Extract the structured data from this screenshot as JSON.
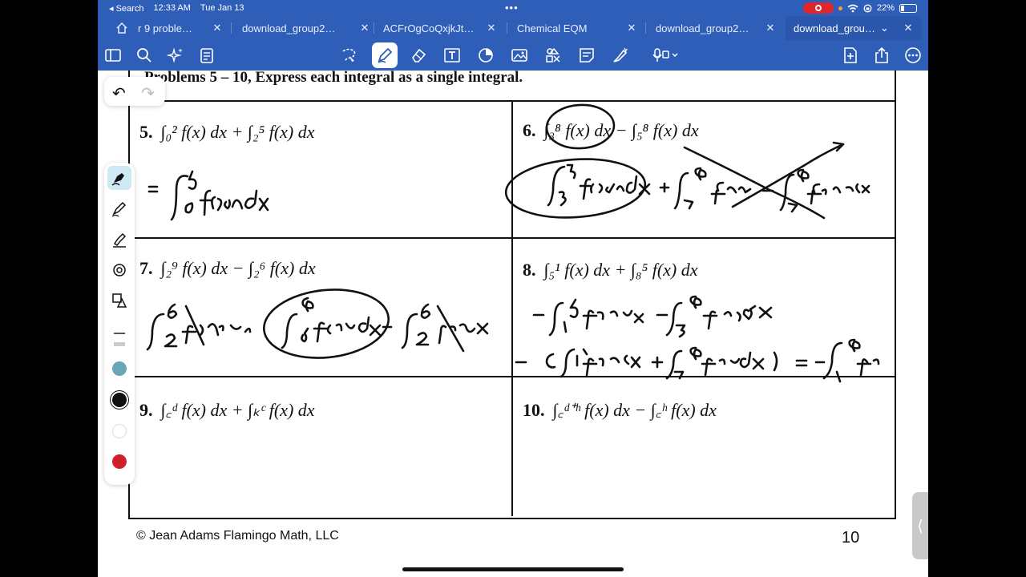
{
  "status_bar": {
    "back_label": "◂ Search",
    "time": "12:33 AM",
    "date": "Tue Jan 13",
    "more_dots": "•••",
    "battery": "22%"
  },
  "tabs": [
    {
      "label": "r 9 proble…",
      "close": "✕"
    },
    {
      "label": "download_group2…",
      "close": "✕"
    },
    {
      "label": "ACFrOgCoQxjkJt…",
      "close": "✕"
    },
    {
      "label": "Chemical EQM",
      "close": "✕"
    },
    {
      "label": "download_group2…",
      "close": "✕"
    },
    {
      "label": "download_grou…",
      "close": "✕",
      "chevron": "⌄"
    }
  ],
  "toolbar": {
    "icons": [
      "sidebar-icon",
      "search-icon",
      "sparkle-icon",
      "clipboard-icon",
      "lasso-icon",
      "pen-icon",
      "eraser-icon",
      "text-box-icon",
      "shape-icon",
      "image-icon",
      "stamp-icon",
      "note-icon",
      "highlighter-icon",
      "voice-icon",
      "add-page-icon",
      "share-icon",
      "more-icon"
    ]
  },
  "document": {
    "heading": "Problems 5 – 10, Express each integral as a single integral.",
    "problems": [
      {
        "number": "5.",
        "expr": "∫₀² f(x) dx + ∫₂⁵ f(x) dx"
      },
      {
        "number": "6.",
        "expr": "∫₃⁸ f(x) dx − ∫₅⁸ f(x) dx"
      },
      {
        "number": "7.",
        "expr": "∫₂⁹ f(x) dx − ∫₂⁶ f(x) dx"
      },
      {
        "number": "8.",
        "expr": "∫₅¹ f(x) dx + ∫₈⁵ f(x) dx"
      },
      {
        "number": "9.",
        "expr": "∫꜀ᵈ f(x) dx + ∫ₖᶜ f(x) dx"
      },
      {
        "number": "10.",
        "expr": "∫꜀ᵈ⁺ʰ f(x) dx − ∫꜀ʰ f(x) dx"
      }
    ],
    "footer_left": "© Jean Adams Flamingo Math, LLC",
    "footer_right": "10"
  },
  "palette": {
    "undo": "↶",
    "redo": "↷",
    "colors": [
      "#6aa6b8",
      "#111111",
      "#ffffff",
      "#d01f2a"
    ]
  }
}
